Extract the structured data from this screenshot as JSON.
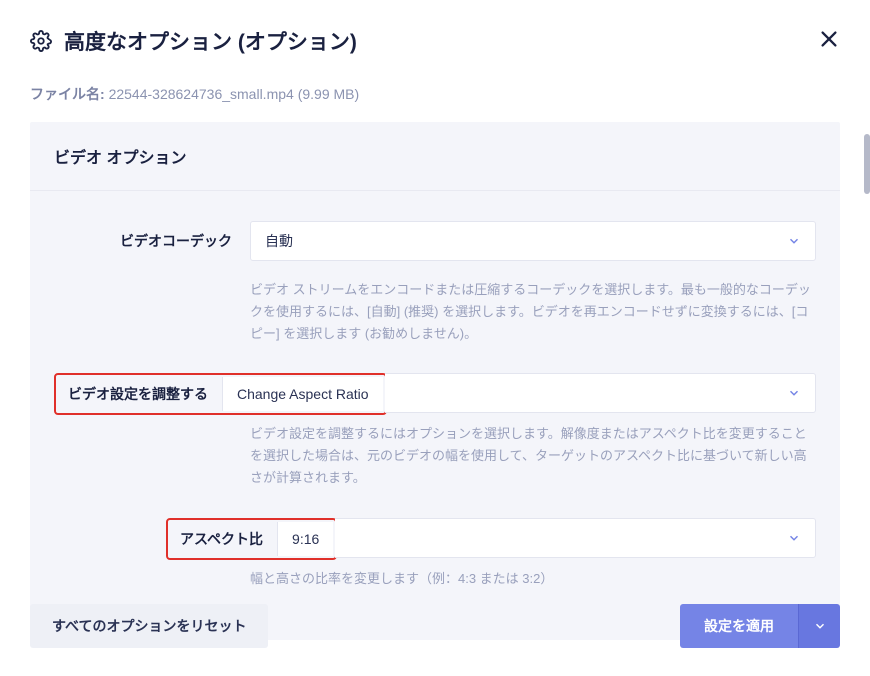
{
  "header": {
    "title": "高度なオプション (オプション)"
  },
  "file": {
    "label": "ファイル名:",
    "name": "22544-328624736_small.mp4",
    "size": "(9.99 MB)"
  },
  "video": {
    "section_title": "ビデオ オプション",
    "codec": {
      "label": "ビデオコーデック",
      "value": "自動",
      "help": "ビデオ ストリームをエンコードまたは圧縮するコーデックを選択します。最も一般的なコーデックを使用するには、[自動] (推奨) を選択します。ビデオを再エンコードせずに変換するには、[コピー] を選択します (お勧めしません)。"
    },
    "adjust": {
      "label": "ビデオ設定を調整する",
      "value": "Change Aspect Ratio",
      "help": "ビデオ設定を調整するにはオプションを選択します。解像度またはアスペクト比を変更することを選択した場合は、元のビデオの幅を使用して、ターゲットのアスペクト比に基づいて新しい高さが計算されます。"
    },
    "aspect": {
      "label": "アスペクト比",
      "value": "9:16",
      "help": "幅と高さの比率を変更します（例：4:3 または 3:2）"
    }
  },
  "footer": {
    "reset": "すべてのオプションをリセット",
    "apply": "設定を適用"
  }
}
